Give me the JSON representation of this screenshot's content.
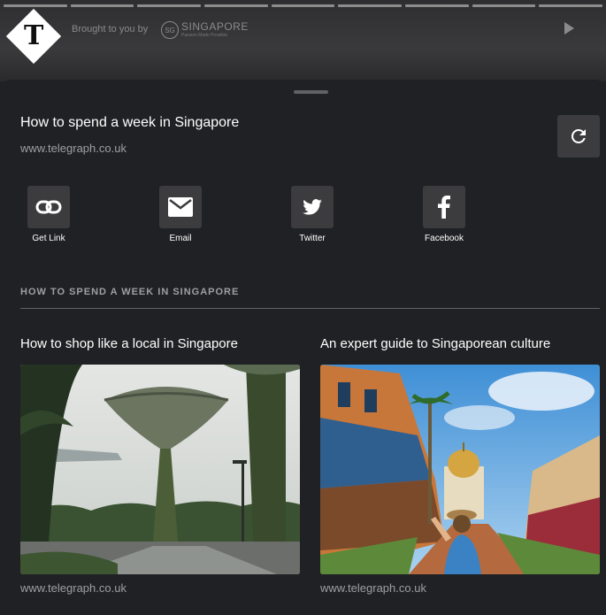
{
  "top_bar": {
    "logo_letter": "T",
    "brought_by": "Brought to you by",
    "sponsor_mark": "SG",
    "sponsor_name": "SINGAPORE",
    "sponsor_tagline": "Passion Made Possible",
    "progress_segments": 9
  },
  "sheet": {
    "title": "How to spend a week in Singapore",
    "domain": "www.telegraph.co.uk",
    "refresh_icon": "refresh-icon"
  },
  "share": [
    {
      "label": "Get Link",
      "icon": "link-icon"
    },
    {
      "label": "Email",
      "icon": "email-icon"
    },
    {
      "label": "Twitter",
      "icon": "twitter-icon"
    },
    {
      "label": "Facebook",
      "icon": "facebook-icon"
    }
  ],
  "related": {
    "heading": "HOW TO SPEND A WEEK IN SINGAPORE",
    "cards": [
      {
        "title": "How to shop like a local in Singapore",
        "domain": "www.telegraph.co.uk"
      },
      {
        "title": "An expert guide to Singaporean culture",
        "domain": "www.telegraph.co.uk"
      }
    ]
  },
  "colors": {
    "background": "#202124",
    "button": "#3c3c3e",
    "muted_text": "#9aa0a6"
  }
}
